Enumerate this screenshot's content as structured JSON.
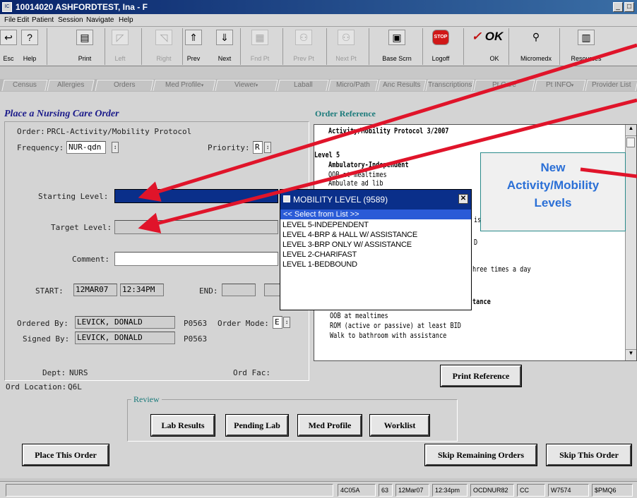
{
  "window": {
    "title": "10014020 ASHFORDTEST, Ina - F"
  },
  "menu": [
    "File",
    "Edit",
    "Patient",
    "Session",
    "Navigate",
    "Help"
  ],
  "toolbar": [
    {
      "label": "Esc",
      "icon": "esc-icon"
    },
    {
      "label": "Help",
      "icon": "help-icon"
    },
    {
      "label": "Print",
      "icon": "printer-icon"
    },
    {
      "label": "Left",
      "icon": "left-icon"
    },
    {
      "label": "Right",
      "icon": "right-icon"
    },
    {
      "label": "Prev",
      "icon": "prev-icon"
    },
    {
      "label": "Next",
      "icon": "next-icon"
    },
    {
      "label": "Fnd Pt",
      "icon": "find-patient-icon"
    },
    {
      "label": "Prev Pt",
      "icon": "prev-patient-icon"
    },
    {
      "label": "Next Pt",
      "icon": "next-patient-icon"
    },
    {
      "label": "Base Scrn",
      "icon": "base-screen-icon"
    },
    {
      "label": "Logoff",
      "icon": "stop-icon"
    },
    {
      "label": "OK",
      "icon": "ok-icon"
    },
    {
      "label": "Micromedx",
      "icon": "search-icon"
    },
    {
      "label": "Resources",
      "icon": "resources-icon"
    }
  ],
  "tabs": [
    "Census",
    "Allergies",
    "Orders",
    "Med Profile",
    "Viewer",
    "Laball",
    "Micro/Path",
    "Anc Results",
    "Transcriptions",
    "Pt Care",
    "Pt INFO",
    "Provider List"
  ],
  "order": {
    "heading": "Place a Nursing Care Order",
    "order_label": "Order:",
    "order_value": "PRCL-Activity/Mobility Protocol",
    "frequency_label": "Frequency:",
    "frequency_value": "NUR-qdn",
    "priority_label": "Priority:",
    "priority_value": "R",
    "starting_level_label": "Starting Level:",
    "target_level_label": "Target Level:",
    "comment_label": "Comment:",
    "start_label": "START:",
    "start_date": "12MAR07",
    "start_time": "12:34PM",
    "end_label": "END:",
    "ordered_by_label": "Ordered By:",
    "ordered_by": "LEVICK, DONALD",
    "ordered_code": "P0563",
    "order_mode_label": "Order Mode:",
    "order_mode_value": "E",
    "signed_by_label": "Signed By:",
    "signed_by": "LEVICK, DONALD",
    "signed_code": "P0563",
    "dept_label": "Dept:",
    "dept_value": "NURS",
    "ord_fac_label": "Ord Fac:",
    "ord_location_label": "Ord Location:",
    "ord_location_value": "Q6L"
  },
  "reference": {
    "heading": "Order Reference",
    "lines": [
      {
        "text": "Activity/Mobility Protocol 3/2007",
        "bold": true
      },
      {
        "text": "Level 5",
        "bold": true
      },
      {
        "text": "Ambulatory-Independent",
        "bold": true
      },
      {
        "text": "OOB at mealtimes",
        "bold": false
      },
      {
        "text": "Ambulate ad lib",
        "bold": false
      },
      {
        "text": "is",
        "bold": false
      },
      {
        "text": "D",
        "bold": false
      },
      {
        "text": "hree times a day",
        "bold": false
      },
      {
        "text": "tance",
        "bold": true
      },
      {
        "text": "OOB at mealtimes",
        "bold": false
      },
      {
        "text": "ROM (active or passive) at least BID",
        "bold": false
      },
      {
        "text": "Walk to bathroom with assistance",
        "bold": false
      }
    ],
    "print_button": "Print Reference"
  },
  "popup": {
    "title": "MOBILITY LEVEL (9589)",
    "header": "<< Select from List        >>",
    "items": [
      "LEVEL 5-INDEPENDENT",
      "LEVEL 4-BRP & HALL W/ ASSISTANCE",
      "LEVEL 3-BRP ONLY W/ ASSISTANCE",
      "LEVEL 2-CHARIFAST",
      "LEVEL 1-BEDBOUND"
    ]
  },
  "callout": {
    "line1": "New",
    "line2": "Activity/Mobility",
    "line3": "Levels"
  },
  "review": {
    "label": "Review",
    "buttons": [
      "Lab Results",
      "Pending Lab",
      "Med Profile",
      "Worklist"
    ]
  },
  "actions": {
    "place_order": "Place This Order",
    "skip_remaining": "Skip Remaining Orders",
    "skip_order": "Skip This Order"
  },
  "status": [
    "4C05A",
    "63",
    "12Mar07",
    "12:34pm",
    "OCDNUR82",
    "CC",
    "W7574",
    "$PMQ6"
  ],
  "colors": {
    "titlebar": "#08246b",
    "selection": "#0a2f8a",
    "arrow": "#e0142a",
    "callout_text": "#2a6fd6"
  }
}
